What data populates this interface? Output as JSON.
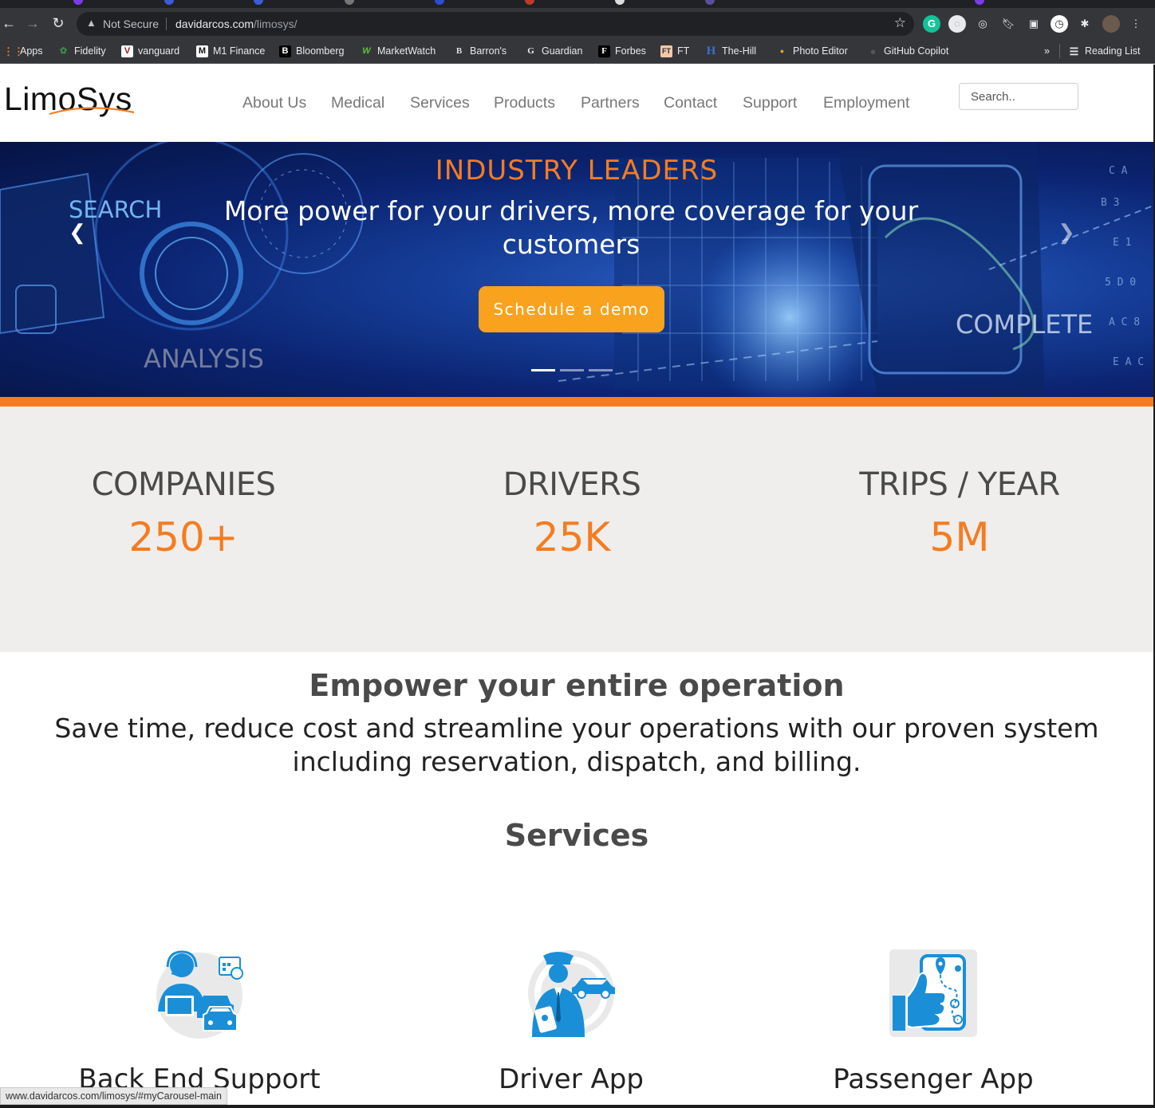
{
  "browser": {
    "security_label": "Not Secure",
    "url_host": "davidarcos.com",
    "url_path": "/limosys/",
    "status_url": "www.davidarcos.com/limosys/#myCarousel-main",
    "bookmarks": [
      {
        "label": "Apps",
        "icon": "apps-grid-icon"
      },
      {
        "label": "Fidelity",
        "icon": "fidelity-icon"
      },
      {
        "label": "vanguard",
        "icon": "vanguard-icon"
      },
      {
        "label": "M1 Finance",
        "icon": "m1-icon"
      },
      {
        "label": "Bloomberg",
        "icon": "bloomberg-icon"
      },
      {
        "label": "MarketWatch",
        "icon": "marketwatch-icon"
      },
      {
        "label": "Barron's",
        "icon": "barrons-icon"
      },
      {
        "label": "Guardian",
        "icon": "guardian-icon"
      },
      {
        "label": "Forbes",
        "icon": "forbes-icon"
      },
      {
        "label": "FT",
        "icon": "ft-icon"
      },
      {
        "label": "The-Hill",
        "icon": "the-hill-icon"
      },
      {
        "label": "Photo Editor",
        "icon": "photo-editor-icon"
      },
      {
        "label": "GitHub Copilot",
        "icon": "github-icon"
      }
    ],
    "overflow_label": "»",
    "reading_list_label": "Reading List"
  },
  "site": {
    "logo_text": "LimoSys",
    "search_placeholder": "Search..",
    "nav": [
      "About Us",
      "Medical",
      "Services",
      "Products",
      "Partners",
      "Contact",
      "Support",
      "Employment"
    ]
  },
  "hero": {
    "eyebrow": "INDUSTRY LEADERS",
    "headline": "More power for your drivers, more coverage for your customers",
    "cta": "Schedule a demo",
    "slide_count": 3,
    "active_slide": 1,
    "bg_words": [
      "SEARCH",
      "ANALYSIS",
      "COMPLETE"
    ]
  },
  "stats": [
    {
      "label": "COMPANIES",
      "value": "250+"
    },
    {
      "label": "DRIVERS",
      "value": "25K"
    },
    {
      "label": "TRIPS / YEAR",
      "value": "5M"
    }
  ],
  "empower": {
    "title": "Empower your entire operation",
    "text": "Save time, reduce cost and streamline your operations with our proven system including reservation, dispatch, and billing."
  },
  "services": {
    "title": "Services",
    "items": [
      {
        "title": "Back End Support",
        "icon": "support-agent-icon"
      },
      {
        "title": "Driver App",
        "icon": "driver-icon"
      },
      {
        "title": "Passenger App",
        "icon": "passenger-app-icon"
      }
    ]
  },
  "colors": {
    "accent": "#f57c20",
    "cta": "#f8a21e",
    "icon_blue": "#1a8fd8",
    "stats_bg": "#efeeec"
  }
}
